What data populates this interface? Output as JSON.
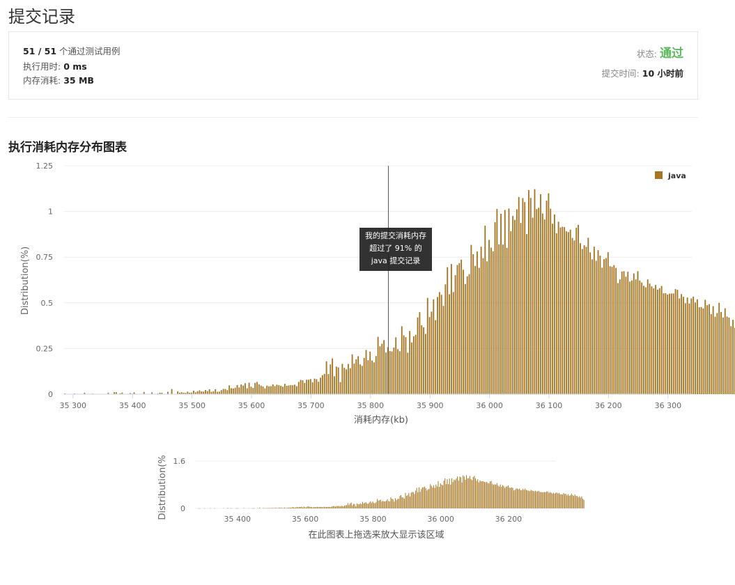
{
  "page": {
    "title": "提交记录"
  },
  "summary": {
    "passed": "51 / 51",
    "passed_suffix": "个通过测试用例",
    "runtime_label": "执行用时:",
    "runtime_value": "0 ms",
    "memory_label": "内存消耗:",
    "memory_value": "35 MB",
    "status_label": "状态:",
    "status_value": "通过",
    "status_color": "#5cb85c",
    "submit_time_label": "提交时间:",
    "submit_time_value": "10 小时前"
  },
  "section": {
    "title": "执行消耗内存分布图表"
  },
  "tooltip": {
    "line1": "我的提交消耗内存",
    "line2": "超过了 91% 的",
    "line3": "java 提交记录"
  },
  "chart_data": [
    {
      "type": "bar",
      "ylabel": "Distribution(%)",
      "xlabel": "消耗内存(kb)",
      "series_name": "java",
      "bar_color": "#a67521",
      "y_ticks": [
        "1.25",
        "1",
        "0.75",
        "0.5",
        "0.25",
        "0"
      ],
      "x_ticks": [
        "35 300",
        "35 400",
        "35 500",
        "35 600",
        "35 700",
        "35 800",
        "35 900",
        "36 000",
        "36 100",
        "36 200",
        "36 300"
      ],
      "ylim": [
        0,
        1.25
      ],
      "xlim": [
        35285,
        36340
      ],
      "marker_x": 35830,
      "legend_position": "top-right",
      "grid": true,
      "x_start": 35286,
      "x_step": 3.333,
      "values": [
        0.004,
        0.002,
        0,
        0,
        0,
        0.004,
        0,
        0,
        0,
        0,
        0.008,
        0,
        0,
        0,
        0.003,
        0,
        0,
        0,
        0,
        0,
        0,
        0,
        0.008,
        0,
        0,
        0.011,
        0.011,
        0,
        0.005,
        0.009,
        0,
        0,
        0,
        0.006,
        0.003,
        0.01,
        0,
        0,
        0,
        0,
        0.012,
        0,
        0,
        0,
        0.01,
        0,
        0,
        0.004,
        0.008,
        0.008,
        0,
        0,
        0.013,
        0,
        0.028,
        0,
        0,
        0.015,
        0.008,
        0.011,
        0.008,
        0.007,
        0.014,
        0.008,
        0.009,
        0.019,
        0.01,
        0.016,
        0.021,
        0.015,
        0.014,
        0.023,
        0.017,
        0.027,
        0.013,
        0.016,
        0.027,
        0.013,
        0.014,
        0.022,
        0.029,
        0.028,
        0.022,
        0.048,
        0.033,
        0.031,
        0.035,
        0.05,
        0.037,
        0.053,
        0.047,
        0.06,
        0.032,
        0.063,
        0.041,
        0.034,
        0.062,
        0.067,
        0.054,
        0.047,
        0.042,
        0.032,
        0.047,
        0.043,
        0.044,
        0.054,
        0.044,
        0.052,
        0.049,
        0.046,
        0.041,
        0.057,
        0.046,
        0.048,
        0.05,
        0.049,
        0.052,
        0.044,
        0.067,
        0.078,
        0.076,
        0.062,
        0.079,
        0.079,
        0.083,
        0.065,
        0.085,
        0.082,
        0.068,
        0.09,
        0.104,
        0.111,
        0.18,
        0.11,
        0.163,
        0.196,
        0.098,
        0.151,
        0.147,
        0.066,
        0.166,
        0.144,
        0.136,
        0.166,
        0.142,
        0.218,
        0.167,
        0.191,
        0.208,
        0.163,
        0.155,
        0.198,
        0.242,
        0.186,
        0.233,
        0.184,
        0.174,
        0.209,
        0.314,
        0.262,
        0.276,
        0.296,
        0.228,
        0.257,
        0.236,
        0.234,
        0.255,
        0.311,
        0.246,
        0.235,
        0.372,
        0.322,
        0.312,
        0.227,
        0.346,
        0.283,
        0.317,
        0.325,
        0.42,
        0.449,
        0.377,
        0.366,
        0.33,
        0.527,
        0.422,
        0.452,
        0.519,
        0.405,
        0.532,
        0.559,
        0.544,
        0.483,
        0.601,
        0.695,
        0.547,
        0.712,
        0.559,
        0.651,
        0.707,
        0.717,
        0.736,
        0.681,
        0.603,
        0.645,
        0.657,
        0.817,
        0.766,
        0.702,
        0.781,
        0.691,
        0.807,
        0.744,
        0.922,
        0.727,
        0.844,
        0.802,
        0.782,
        0.941,
        1.014,
        0.82,
        0.987,
        0.819,
        1.008,
        0.801,
        1.016,
        0.892,
        0.975,
        0.954,
        1.012,
        1.079,
        0.937,
        1.073,
        1.051,
        0.876,
        1.117,
        1.074,
        0.966,
        1.122,
        1.013,
        1.02,
        1.094,
        0.989,
        0.956,
        1.059,
        1.099,
        1.015,
        0.933,
        0.983,
        0.88,
        0.944,
        0.912,
        0.916,
        0.914,
        0.891,
        0.887,
        0.9,
        0.855,
        0.841,
        0.911,
        0.927,
        0.826,
        0.794,
        0.815,
        0.806,
        0.856,
        0.776,
        0.738,
        0.807,
        0.73,
        0.788,
        0.758,
        0.692,
        0.739,
        0.745,
        0.777,
        0.7,
        0.697,
        0.706,
        0.691,
        0.608,
        0.628,
        0.671,
        0.673,
        0.643,
        0.67,
        0.616,
        0.622,
        0.661,
        0.628,
        0.673,
        0.622,
        0.611,
        0.593,
        0.585,
        0.628,
        0.605,
        0.59,
        0.579,
        0.598,
        0.572,
        0.58,
        0.592,
        0.552,
        0.553,
        0.545,
        0.55,
        0.551,
        0.551,
        0.575,
        0.571,
        0.524,
        0.548,
        0.533,
        0.498,
        0.529,
        0.496,
        0.524,
        0.534,
        0.502,
        0.519,
        0.476,
        0.477,
        0.469,
        0.517,
        0.487,
        0.493,
        0.438,
        0.482,
        0.424,
        0.444,
        0.5,
        0.45,
        0.42,
        0.47,
        0.425,
        0.419,
        0.372,
        0.407,
        0.363,
        0.4,
        0.325,
        0.285
      ]
    },
    {
      "type": "bar",
      "ylabel": "Distribution(%",
      "caption": "在此图表上拖选来放大显示该区域",
      "y_ticks": [
        "1.6",
        "0"
      ],
      "x_ticks": [
        "35 400",
        "35 600",
        "35 800",
        "36 000",
        "36 200"
      ],
      "ylim": [
        0,
        1.6
      ],
      "xlim": [
        35275,
        36340
      ]
    }
  ]
}
